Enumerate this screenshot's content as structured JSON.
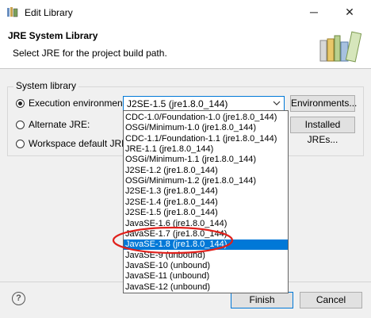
{
  "window": {
    "title": "Edit Library"
  },
  "header": {
    "title": "JRE System Library",
    "subtitle": "Select JRE for the project build path."
  },
  "group": {
    "label": "System library",
    "execution_env_label": "Execution environment:",
    "execution_env_value": "J2SE-1.5 (jre1.8.0_144)",
    "alternate_jre_label": "Alternate JRE:",
    "workspace_default_label": "Workspace default JRE (jre"
  },
  "buttons": {
    "environments": "Environments...",
    "installed_jres": "Installed JREs...",
    "finish": "Finish",
    "cancel": "Cancel"
  },
  "dropdown": {
    "selected_index": 12,
    "circled_items": [
      11,
      12
    ],
    "items": [
      "CDC-1.0/Foundation-1.0 (jre1.8.0_144)",
      "OSGi/Minimum-1.0 (jre1.8.0_144)",
      "CDC-1.1/Foundation-1.1 (jre1.8.0_144)",
      "JRE-1.1 (jre1.8.0_144)",
      "OSGi/Minimum-1.1 (jre1.8.0_144)",
      "J2SE-1.2 (jre1.8.0_144)",
      "OSGi/Minimum-1.2 (jre1.8.0_144)",
      "J2SE-1.3 (jre1.8.0_144)",
      "J2SE-1.4 (jre1.8.0_144)",
      "J2SE-1.5 (jre1.8.0_144)",
      "JavaSE-1.6 (jre1.8.0_144)",
      "JavaSE-1.7 (jre1.8.0_144)",
      "JavaSE-1.8 (jre1.8.0_144)",
      "JavaSE-9 (unbound)",
      "JavaSE-10 (unbound)",
      "JavaSE-11 (unbound)",
      "JavaSE-12 (unbound)"
    ]
  },
  "colors": {
    "accent": "#0078d7",
    "highlight_circle": "#e0201b"
  },
  "icons": {
    "app": "library-icon",
    "header": "books-icon",
    "help": "help-icon"
  }
}
